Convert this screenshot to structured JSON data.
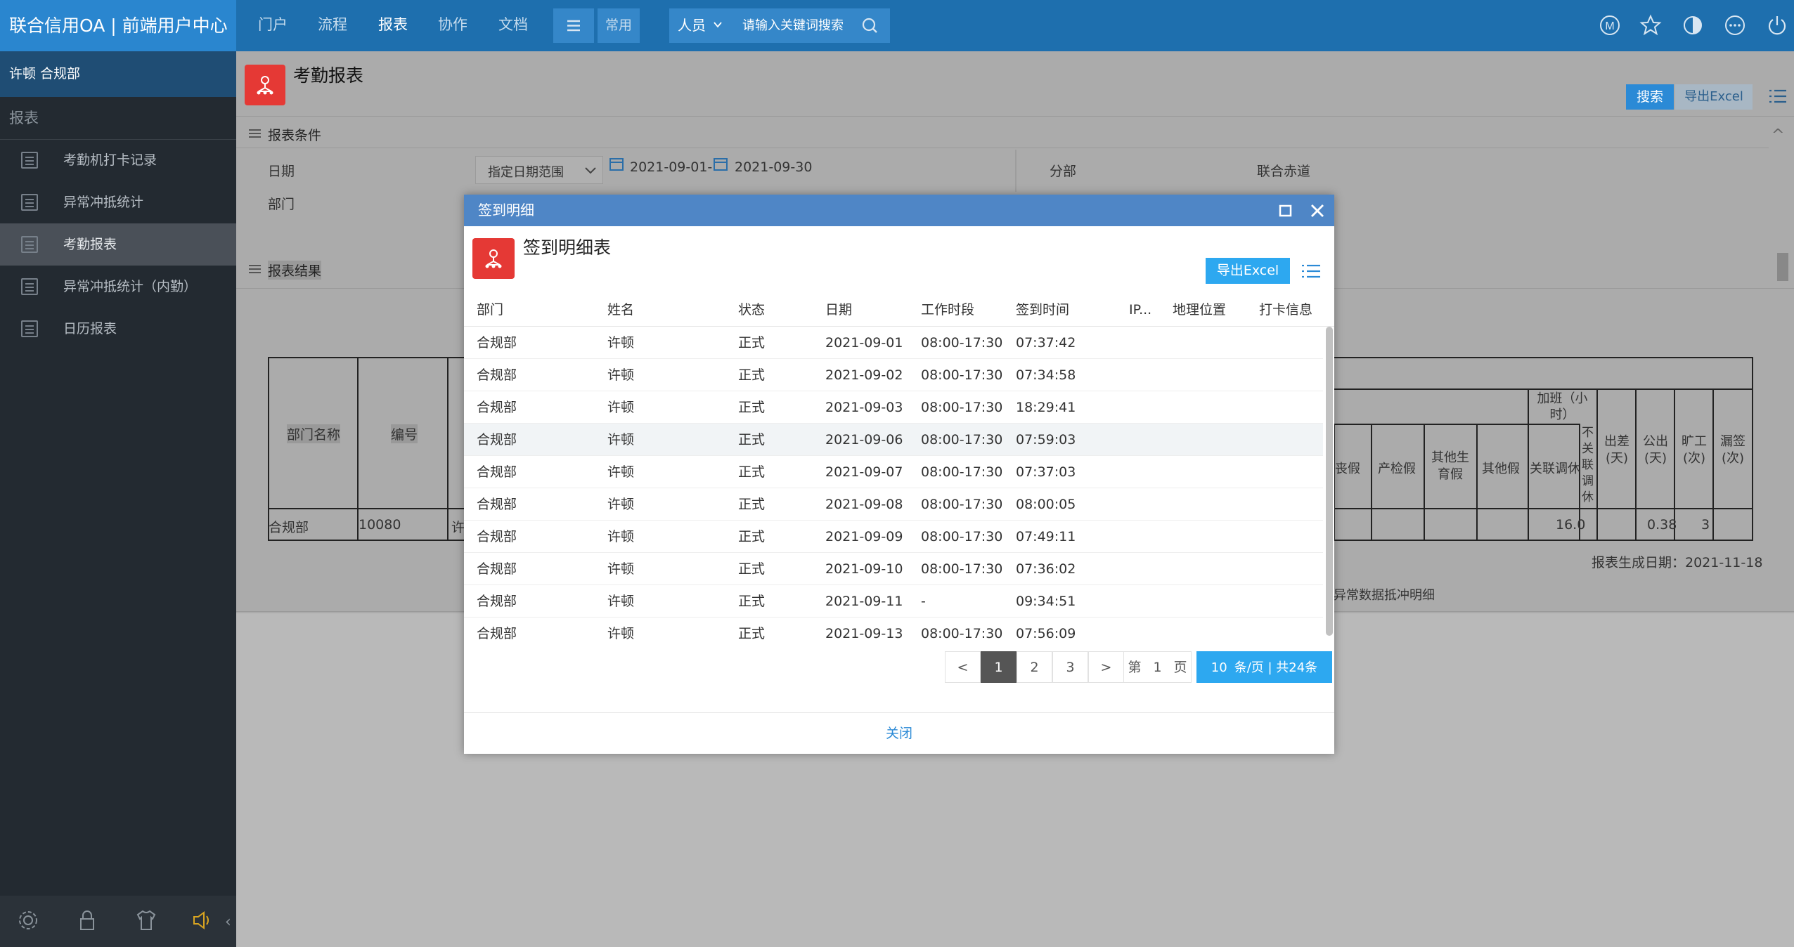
{
  "header": {
    "brand": "联合信用OA | 前端用户中心",
    "nav": [
      "门户",
      "流程",
      "报表",
      "协作",
      "文档"
    ],
    "common_label": "常用",
    "search_scope": "人员",
    "search_placeholder": "请输入关键词搜索",
    "right_icons": [
      "user-m-icon",
      "star-icon",
      "theme-icon",
      "more-icon",
      "power-icon"
    ]
  },
  "sidebar": {
    "user": "许顿 合规部",
    "section": "报表",
    "items": [
      {
        "label": "考勤机打卡记录"
      },
      {
        "label": "异常冲抵统计"
      },
      {
        "label": "考勤报表"
      },
      {
        "label": "异常冲抵统计（内勤）"
      },
      {
        "label": "日历报表"
      }
    ],
    "bottom_icons": [
      "settings-icon",
      "lock-icon",
      "shirt-icon",
      "speaker-icon"
    ]
  },
  "page": {
    "title": "考勤报表",
    "search_btn": "搜索",
    "export_btn": "导出Excel",
    "conditions_title": "报表条件",
    "date_label": "日期",
    "date_mode": "指定日期范围",
    "date_from": "2021-09-01-",
    "date_to": "2021-09-30",
    "branch_label": "分部",
    "branch_value": "联合赤道",
    "dept_label": "部门",
    "results_title": "报表结果",
    "col_dept": "部门名称",
    "col_no": "编号",
    "overtime": "加班（小时）",
    "col_leave1": "丧假",
    "col_leave2": "产检假",
    "col_leave3": "其他生育假",
    "col_leave4": "其他假",
    "col_rest": "关联调休",
    "col_norest": "不关联调休",
    "col_trip": "出差(天)",
    "col_official": "公出(天)",
    "col_absent": "旷工(次)",
    "col_miss": "漏签(次)",
    "row_dept": "合规部",
    "row_no": "10080",
    "row_name": "许",
    "row_rest": "16.0",
    "row_official": "0.38",
    "row_absent": "3",
    "generated": "报表生成日期：2021-11-18",
    "note": "异常数据抵冲明细"
  },
  "modal": {
    "title": "签到明细",
    "heading": "签到明细表",
    "export_btn": "导出Excel",
    "close_btn": "关闭",
    "columns": [
      "部门",
      "姓名",
      "状态",
      "日期",
      "工作时段",
      "签到时间",
      "IP...",
      "地理位置",
      "打卡信息"
    ],
    "rows": [
      [
        "合规部",
        "许顿",
        "正式",
        "2021-09-01",
        "08:00-17:30",
        "07:37:42"
      ],
      [
        "合规部",
        "许顿",
        "正式",
        "2021-09-02",
        "08:00-17:30",
        "07:34:58"
      ],
      [
        "合规部",
        "许顿",
        "正式",
        "2021-09-03",
        "08:00-17:30",
        "18:29:41"
      ],
      [
        "合规部",
        "许顿",
        "正式",
        "2021-09-06",
        "08:00-17:30",
        "07:59:03"
      ],
      [
        "合规部",
        "许顿",
        "正式",
        "2021-09-07",
        "08:00-17:30",
        "07:37:03"
      ],
      [
        "合规部",
        "许顿",
        "正式",
        "2021-09-08",
        "08:00-17:30",
        "08:00:05"
      ],
      [
        "合规部",
        "许顿",
        "正式",
        "2021-09-09",
        "08:00-17:30",
        "07:49:11"
      ],
      [
        "合规部",
        "许顿",
        "正式",
        "2021-09-10",
        "08:00-17:30",
        "07:36:02"
      ],
      [
        "合规部",
        "许顿",
        "正式",
        "2021-09-11",
        "-",
        "09:34:51"
      ],
      [
        "合规部",
        "许顿",
        "正式",
        "2021-09-13",
        "08:00-17:30",
        "07:56:09"
      ]
    ],
    "pager": {
      "prev": "<",
      "pages": [
        "1",
        "2",
        "3"
      ],
      "next": ">",
      "goto_prefix": "第",
      "goto_value": "1",
      "goto_suffix": "页",
      "page_size": "10",
      "summary": "条/页 | 共24条"
    }
  }
}
